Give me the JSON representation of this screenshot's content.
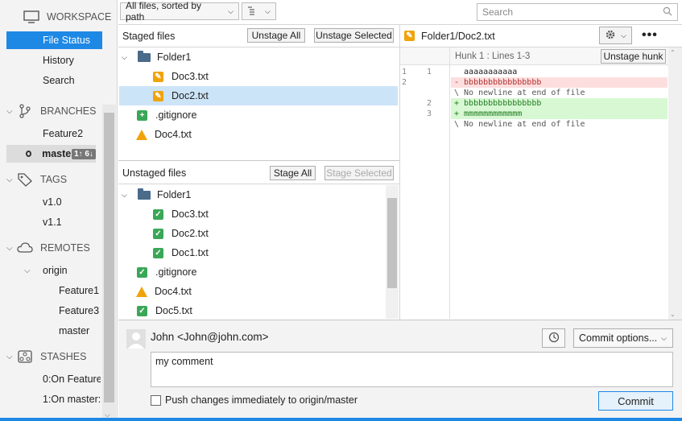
{
  "sidebar": {
    "workspace": "WORKSPACE",
    "file_status": "File Status",
    "history": "History",
    "search": "Search",
    "branches": "BRANCHES",
    "branch_items": [
      "Feature2",
      "master"
    ],
    "branch_badge": "1↑ 6↓",
    "tags": "TAGS",
    "tag_items": [
      "v1.0",
      "v1.1"
    ],
    "remotes": "REMOTES",
    "remote_origin": "origin",
    "remote_items": [
      "Feature1",
      "Feature3",
      "master"
    ],
    "stashes": "STASHES",
    "stash_items": [
      "0:On Feature",
      "1:On master:"
    ]
  },
  "toolbar": {
    "sort_label": "All files, sorted by path",
    "search_placeholder": "Search"
  },
  "staged": {
    "title": "Staged files",
    "unstage_all": "Unstage All",
    "unstage_selected": "Unstage Selected",
    "folder": "Folder1",
    "files": [
      "Doc3.txt",
      "Doc2.txt"
    ],
    "root_files": [
      ".gitignore",
      "Doc4.txt"
    ]
  },
  "unstaged": {
    "title": "Unstaged files",
    "stage_all": "Stage All",
    "stage_selected": "Stage Selected",
    "folder": "Folder1",
    "files": [
      "Doc3.txt",
      "Doc2.txt",
      "Doc1.txt"
    ],
    "root_files": [
      ".gitignore",
      "Doc4.txt",
      "Doc5.txt"
    ]
  },
  "diff": {
    "file": "Folder1/Doc2.txt",
    "hunk": "Hunk 1 : Lines 1-3",
    "unstage_hunk": "Unstage hunk",
    "lines": [
      {
        "old": "1",
        "new": "1",
        "text": "  aaaaaaaaaaa",
        "kind": "ctx"
      },
      {
        "old": "2",
        "new": "",
        "text": "- bbbbbbbbbbbbbbbb",
        "kind": "del"
      },
      {
        "old": "",
        "new": "",
        "text": "\\ No newline at end of file",
        "kind": "ctx"
      },
      {
        "old": "",
        "new": "2",
        "text": "+ bbbbbbbbbbbbbbbb",
        "kind": "add"
      },
      {
        "old": "",
        "new": "3",
        "text": "+ mmmmmmmmmmmm",
        "kind": "add"
      },
      {
        "old": "",
        "new": "",
        "text": "\\ No newline at end of file",
        "kind": "ctx"
      }
    ]
  },
  "commit": {
    "author": "John <John@john.com>",
    "options": "Commit options...",
    "message": "my comment",
    "push_label": "Push changes immediately to origin/master",
    "commit_button": "Commit"
  },
  "colors": {
    "accent": "#1e88e5",
    "del_bg": "#fddede",
    "add_bg": "#d7f8d3",
    "modified": "#f0a30a",
    "added": "#3aa757"
  }
}
